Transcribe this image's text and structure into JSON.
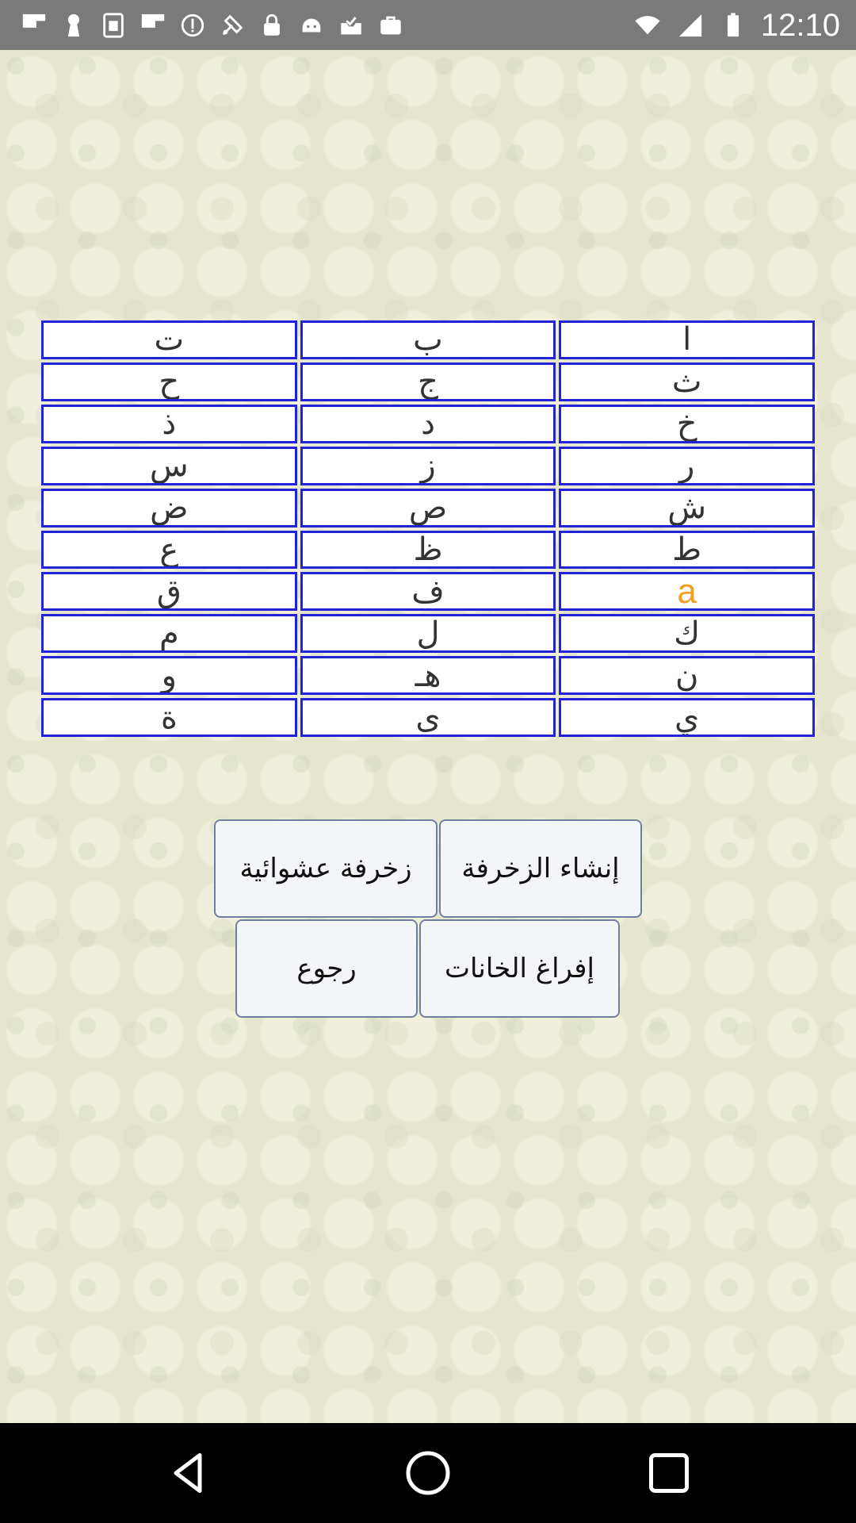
{
  "status_bar": {
    "time": "12:10",
    "icons": [
      "flipboard-icon",
      "keyhole-icon",
      "sim-icon",
      "flipboard-icon",
      "info-circle-icon",
      "fake-gps-icon",
      "lock-icon",
      "android-icon",
      "inbox-icon",
      "briefcase-icon"
    ]
  },
  "grid": {
    "rows": [
      [
        "ا",
        "ب",
        "ت"
      ],
      [
        "ث",
        "ج",
        "ح"
      ],
      [
        "خ",
        "د",
        "ذ"
      ],
      [
        "ر",
        "ز",
        "س"
      ],
      [
        "ش",
        "ص",
        "ض"
      ],
      [
        "ط",
        "ظ",
        "ع"
      ],
      [
        "a",
        "ف",
        "ق"
      ],
      [
        "ك",
        "ل",
        "م"
      ],
      [
        "ن",
        "هـ",
        "و"
      ],
      [
        "ي",
        "ى",
        "ة"
      ]
    ],
    "highlight_color": "#f0a020",
    "border_color": "#2222d6"
  },
  "buttons": {
    "create_label": "إنشاء الزخرفة",
    "random_label": "زخرفة عشوائية",
    "clear_label": "إفراغ الخانات",
    "back_label": "رجوع"
  },
  "nav": {
    "back": "back-icon",
    "home": "home-icon",
    "recents": "recents-icon"
  }
}
